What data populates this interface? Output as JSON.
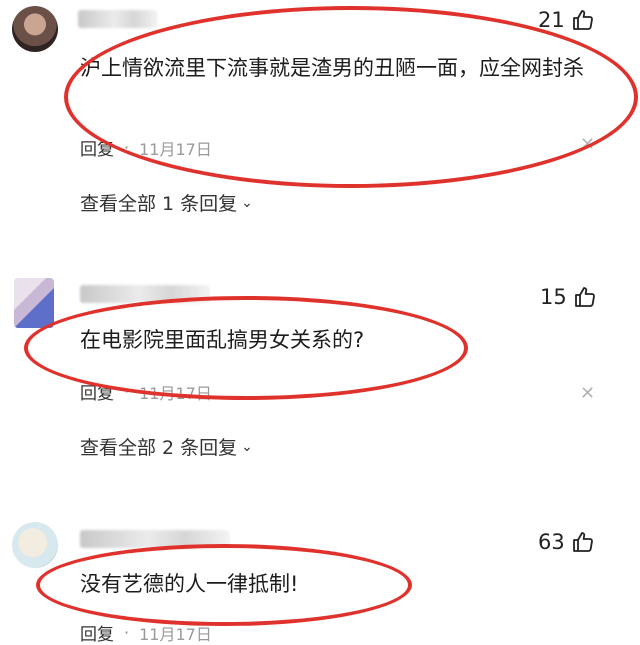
{
  "comments": [
    {
      "likes": "21",
      "text": "沪上情欲流里下流事就是渣男的丑陋一面，应全网封杀",
      "reply_label": "回复",
      "separator": "·",
      "date": "11月17日",
      "view_all": "查看全部 1 条回复"
    },
    {
      "likes": "15",
      "text": "在电影院里面乱搞男女关系的?",
      "reply_label": "回复",
      "separator": "·",
      "date": "11月17日",
      "view_all": "查看全部 2 条回复"
    },
    {
      "likes": "63",
      "text": "没有艺德的人一律抵制!",
      "reply_label": "回复",
      "separator": "·",
      "date": "11月17日"
    }
  ],
  "icons": {
    "like": "thumbs-up-icon",
    "close": "close-icon",
    "chevron": "chevron-down-icon"
  },
  "colors": {
    "highlight_oval": "#e0322c"
  }
}
